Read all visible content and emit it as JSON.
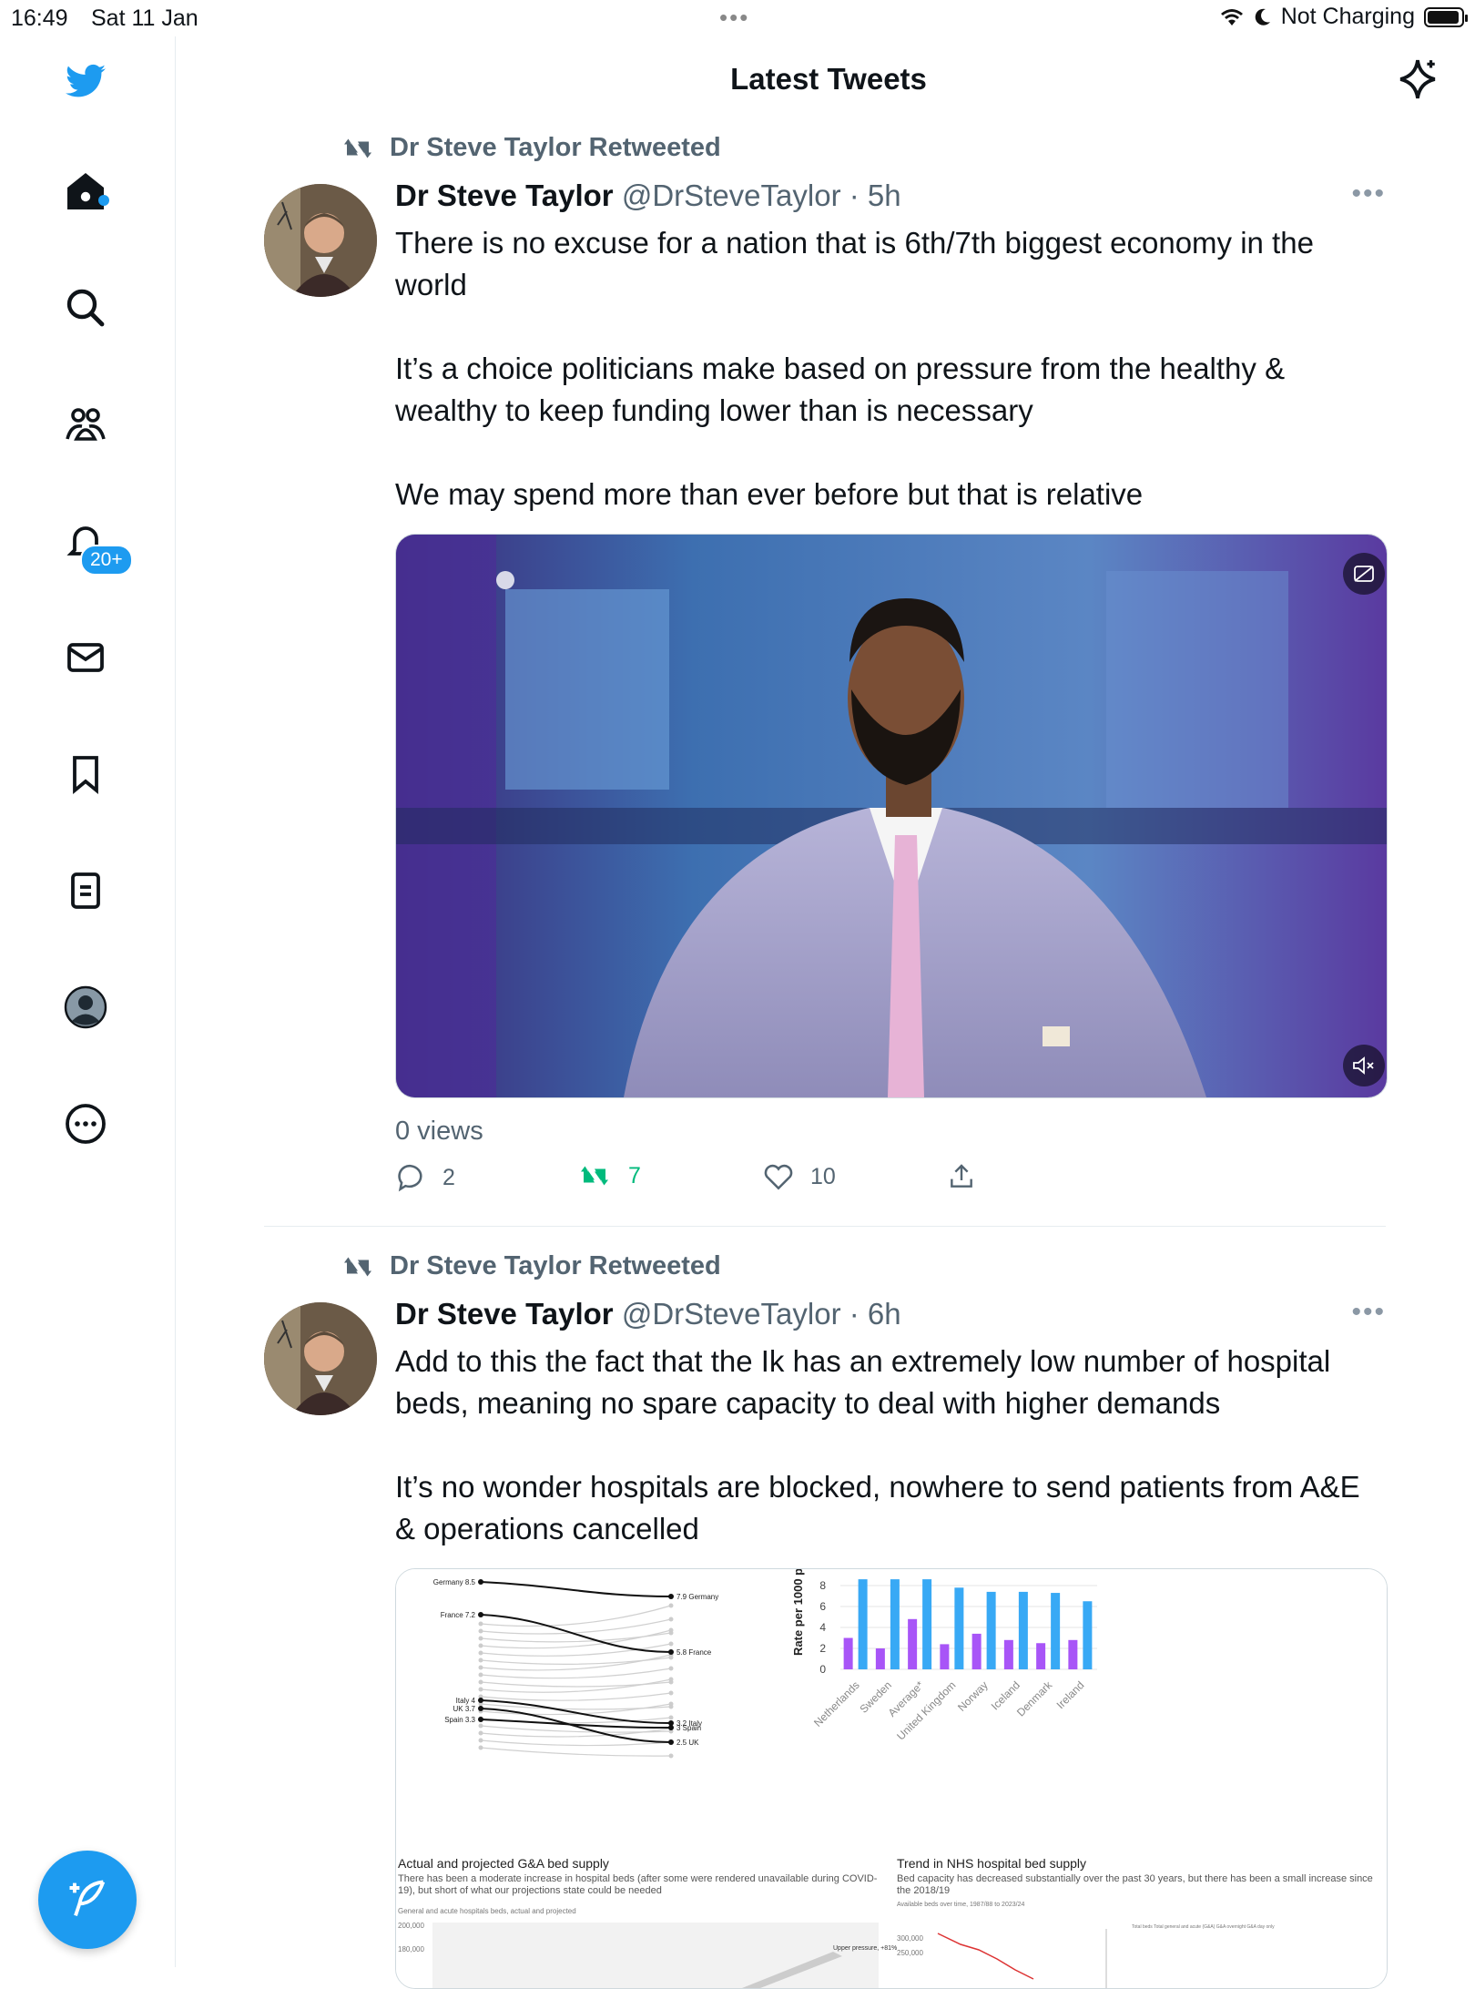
{
  "status_bar": {
    "time": "16:49",
    "date": "Sat 11 Jan",
    "charging": "Not Charging"
  },
  "header": {
    "title": "Latest Tweets"
  },
  "sidebar": {
    "notification_badge": "20+"
  },
  "tweets": [
    {
      "retweeted_by": "Dr Steve Taylor Retweeted",
      "name": "Dr Steve Taylor",
      "handle": "@DrSteveTaylor",
      "time": "· 5h",
      "paragraphs": [
        "There is no excuse for a nation that is 6th/7th biggest economy in the world",
        "It’s a choice politicians make based on pressure from the healthy & wealthy to keep funding lower than is necessary",
        "We may spend more than ever before but that is relative"
      ],
      "views": "0 views",
      "replies": "2",
      "retweets": "7",
      "likes": "10"
    },
    {
      "retweeted_by": "Dr Steve Taylor Retweeted",
      "name": "Dr Steve Taylor",
      "handle": "@DrSteveTaylor",
      "time": "· 6h",
      "paragraphs": [
        "Add to this the fact that the Ik has an extremely low number of hospital beds, meaning no spare capacity to deal with higher demands",
        "It’s no wonder hospitals are blocked, nowhere to send patients from A&E & operations cancelled"
      ]
    }
  ],
  "media_chart": {
    "slope_left_labels": [
      "Germany 8.5",
      "France 7.2",
      "Italy 4",
      "UK 3.7",
      "Spain 3.3"
    ],
    "slope_right_labels": [
      "7.9 Germany",
      "5.8 France",
      "3.2 Italy",
      "3 Spain",
      "2.5 UK"
    ],
    "ylabel": "Rate per 1000 p",
    "yticks": [
      "8",
      "6",
      "4",
      "2",
      "0"
    ],
    "countries": [
      "Netherlands",
      "Sweden",
      "Average*",
      "United Kingdom",
      "Norway",
      "Iceland",
      "Denmark",
      "Ireland"
    ],
    "bars_blue": [
      8.6,
      8.6,
      8.6,
      7.8,
      7.4,
      7.4,
      7.3,
      6.5
    ],
    "bars_purple": [
      3.0,
      2.0,
      4.8,
      2.4,
      3.4,
      2.8,
      2.5,
      2.8
    ],
    "panel_left_title": "Actual and projected G&A bed supply",
    "panel_left_sub": "There has been a moderate increase in hospital beds (after some were rendered unavailable during COVID-19), but short of what our projections state could be needed",
    "panel_left_note": "General and acute hospitals beds, actual and projected",
    "panel_left_ticks": [
      "200,000",
      "180,000"
    ],
    "panel_left_upper": "Upper pressure, +81%",
    "panel_right_title": "Trend in NHS hospital bed supply",
    "panel_right_sub": "Bed capacity has decreased substantially over the past 30 years, but there has been a small increase since the 2018/19",
    "panel_right_note": "Available beds over time, 1987/88 to 2023/24",
    "panel_right_ticks": [
      "300,000",
      "250,000"
    ],
    "panel_right_legend": "Total beds  Total general and acute (G&A)  G&A overnight  G&A day only"
  }
}
